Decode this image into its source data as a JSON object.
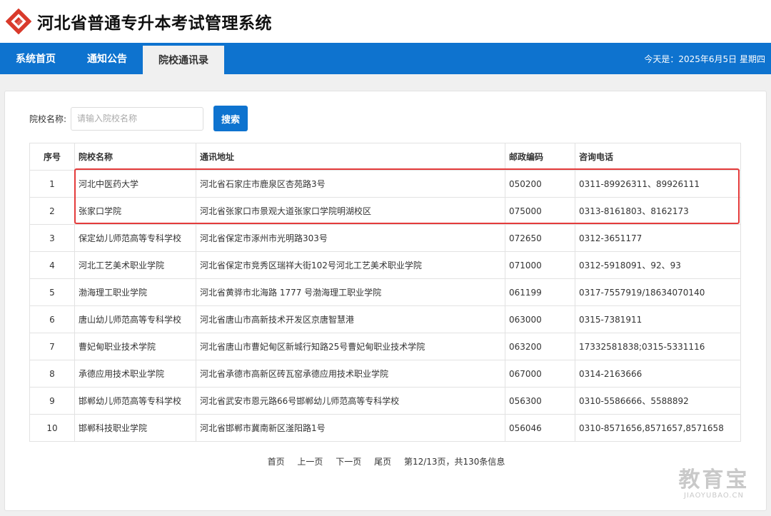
{
  "header": {
    "title": "河北省普通专升本考试管理系统",
    "logo_color": "#d93a2b"
  },
  "nav": {
    "items": [
      {
        "label": "系统首页"
      },
      {
        "label": "通知公告"
      },
      {
        "label": "院校通讯录"
      }
    ],
    "active_index": 2,
    "today": "今天是：2025年6月5日 星期四"
  },
  "search": {
    "label": "院校名称:",
    "placeholder": "请输入院校名称",
    "value": "",
    "button": "搜索"
  },
  "table": {
    "headers": [
      "序号",
      "院校名称",
      "通讯地址",
      "邮政编码",
      "咨询电话"
    ],
    "rows": [
      [
        "1",
        "河北中医药大学",
        "河北省石家庄市鹿泉区杏苑路3号",
        "050200",
        "0311-89926311、89926111"
      ],
      [
        "2",
        "张家口学院",
        "河北省张家口市景观大道张家口学院明湖校区",
        "075000",
        "0313-8161803、8162173"
      ],
      [
        "3",
        "保定幼儿师范高等专科学校",
        "河北省保定市涿州市光明路303号",
        "072650",
        "0312-3651177"
      ],
      [
        "4",
        "河北工艺美术职业学院",
        "河北省保定市竞秀区瑞祥大街102号河北工艺美术职业学院",
        "071000",
        "0312-5918091、92、93"
      ],
      [
        "5",
        "渤海理工职业学院",
        "河北省黄骅市北海路 1777 号渤海理工职业学院",
        "061199",
        "0317-7557919/18634070140"
      ],
      [
        "6",
        "唐山幼儿师范高等专科学校",
        "河北省唐山市高新技术开发区京唐智慧港",
        "063000",
        "0315-7381911"
      ],
      [
        "7",
        "曹妃甸职业技术学院",
        "河北省唐山市曹妃甸区新城行知路25号曹妃甸职业技术学院",
        "063200",
        "17332581838;0315-5331116"
      ],
      [
        "8",
        "承德应用技术职业学院",
        "河北省承德市高新区砖瓦窑承德应用技术职业学院",
        "067000",
        "0314-2163666"
      ],
      [
        "9",
        "邯郸幼儿师范高等专科学校",
        "河北省武安市恩元路66号邯郸幼儿师范高等专科学校",
        "056300",
        "0310-5586666、5588892"
      ],
      [
        "10",
        "邯郸科技职业学院",
        "河北省邯郸市冀南新区滏阳路1号",
        "056046",
        "0310-8571656,8571657,8571658"
      ]
    ]
  },
  "pager": {
    "first": "首页",
    "prev": "上一页",
    "next": "下一页",
    "last": "尾页",
    "info": "第12/13页，共130条信息"
  },
  "watermark": {
    "cn": "教育宝",
    "en": "JIAOYUBAO.CN"
  },
  "colors": {
    "nav_blue": "#0e73cf",
    "highlight_red": "#e43b3b"
  }
}
